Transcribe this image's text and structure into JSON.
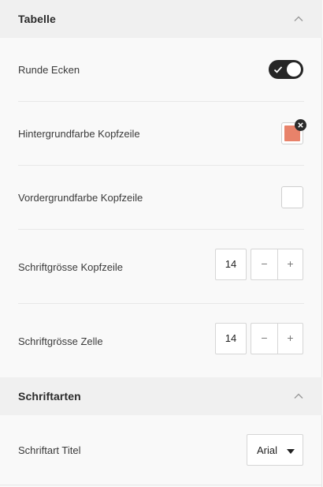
{
  "sections": [
    {
      "title": "Tabelle",
      "expanded": true,
      "icon": "chevron-up-icon"
    },
    {
      "title": "Schriftarten",
      "expanded": true,
      "icon": "chevron-up-icon"
    }
  ],
  "table": {
    "rounded_corners": {
      "label": "Runde Ecken",
      "on": true
    },
    "header_bg_color": {
      "label": "Hintergrundfarbe Kopfzeile",
      "color": "#e8826a",
      "clear_icon": "close-icon"
    },
    "header_fg_color": {
      "label": "Vordergrundfarbe Kopfzeile",
      "color": "#ffffff"
    },
    "header_font_size": {
      "label": "Schriftgrösse Kopfzeile",
      "value": "14",
      "minus": "−",
      "plus": "+"
    },
    "cell_font_size": {
      "label": "Schriftgrösse Zelle",
      "value": "14",
      "minus": "−",
      "plus": "+"
    }
  },
  "fonts": {
    "title_font": {
      "label": "Schriftart Titel",
      "value": "Arial",
      "icon": "caret-down-icon"
    }
  },
  "colors": {
    "toggle_on": "#262626",
    "header_bg": "#f0f0f0",
    "panel_bg": "#f9f9f9"
  }
}
